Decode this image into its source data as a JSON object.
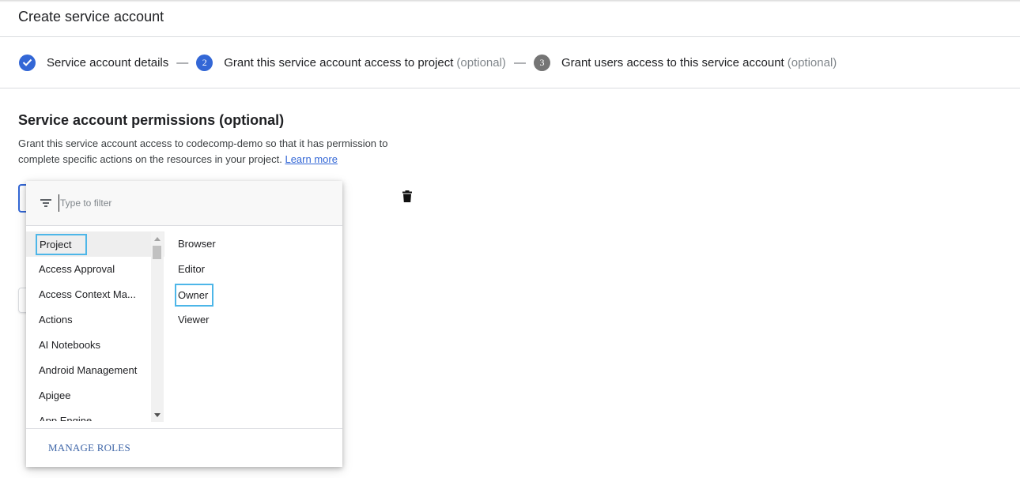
{
  "page": {
    "title": "Create service account"
  },
  "stepper": {
    "steps": [
      {
        "number": "",
        "label": "Service account details",
        "optional": "",
        "state": "done",
        "icon": "check-icon"
      },
      {
        "number": "2",
        "label": "Grant this service account access to project",
        "optional": "(optional)",
        "state": "active"
      },
      {
        "number": "3",
        "label": "Grant users access to this service account",
        "optional": "(optional)",
        "state": "pending"
      }
    ],
    "separator": "—"
  },
  "permissions": {
    "title": "Service account permissions (optional)",
    "description": "Grant this service account access to codecomp-demo so that it has permission to complete specific actions on the resources in your project.",
    "learn_more": "Learn more",
    "delete_icon": "trash-icon"
  },
  "role_dropdown": {
    "filter": {
      "icon": "filter-icon",
      "placeholder": "Type to filter",
      "value": ""
    },
    "categories": [
      {
        "label": "Project",
        "selected": true,
        "focused": true
      },
      {
        "label": "Access Approval"
      },
      {
        "label": "Access Context Ma..."
      },
      {
        "label": "Actions"
      },
      {
        "label": "AI Notebooks"
      },
      {
        "label": "Android Management"
      },
      {
        "label": "Apigee"
      },
      {
        "label": "App Engine"
      }
    ],
    "roles": [
      {
        "label": "Browser"
      },
      {
        "label": "Editor"
      },
      {
        "label": "Owner",
        "focused": true
      },
      {
        "label": "Viewer"
      }
    ],
    "footer": {
      "manage_roles": "MANAGE ROLES"
    }
  },
  "colors": {
    "accent": "#3367d6",
    "focus_ring": "#4db6e8",
    "pending_step": "#757575",
    "link": "#3f66a8"
  }
}
